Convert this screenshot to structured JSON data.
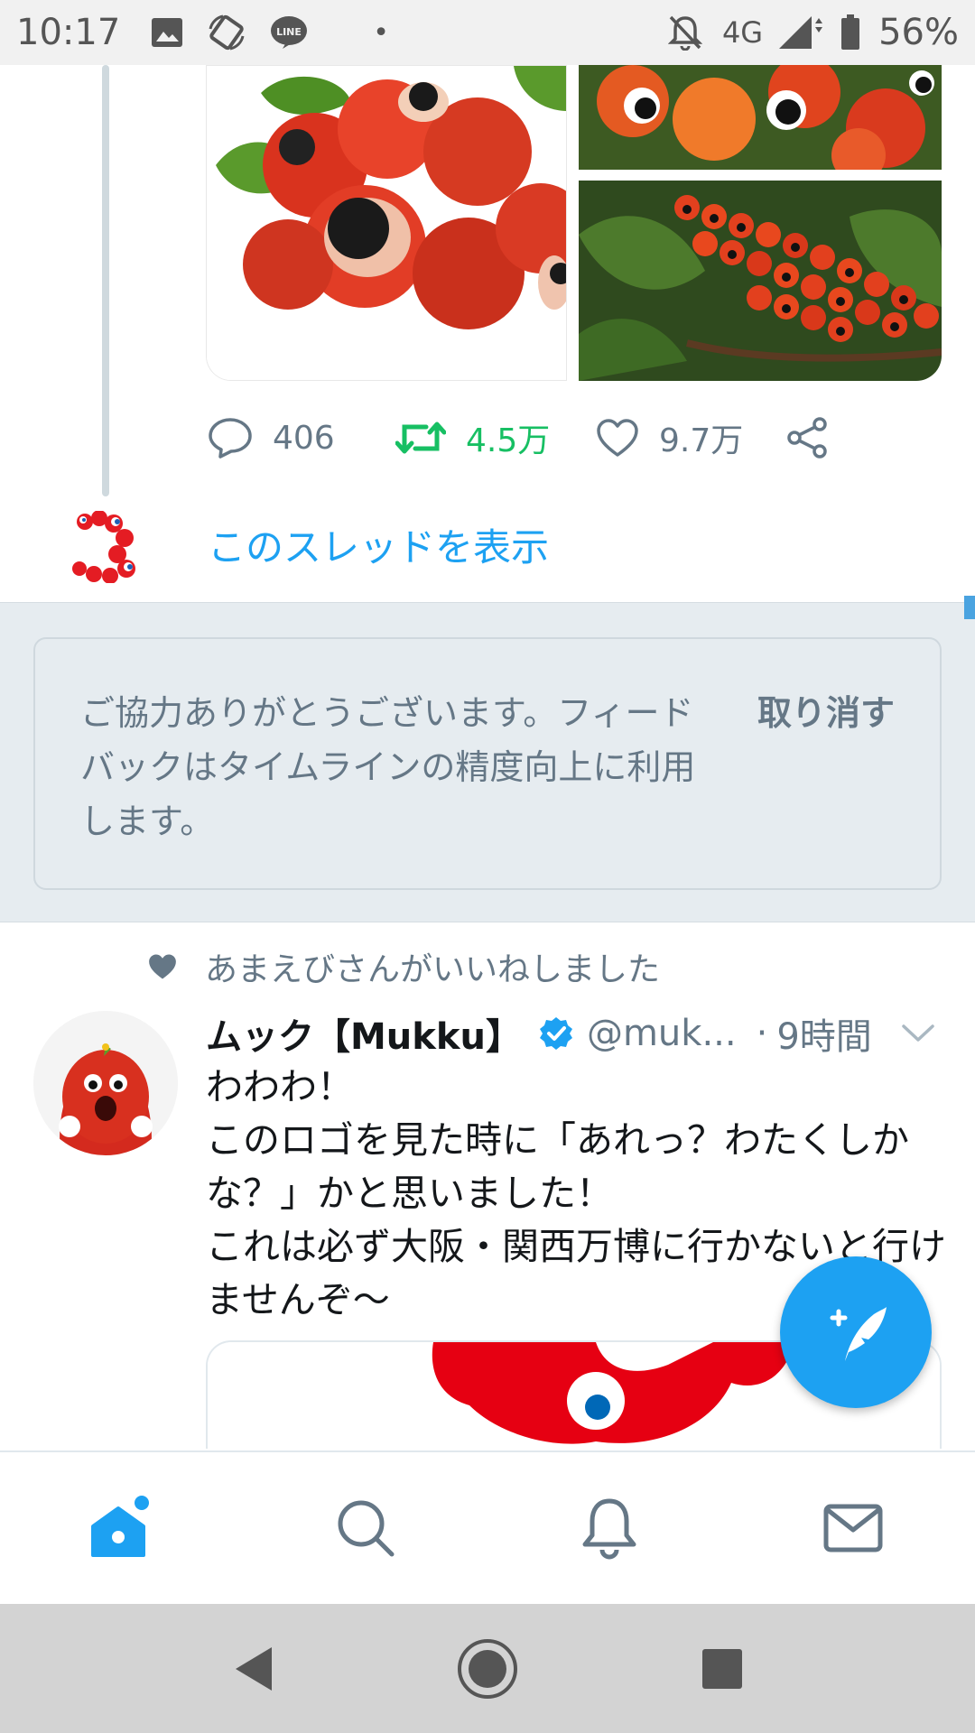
{
  "status_bar": {
    "time": "10:17",
    "network": "4G",
    "battery": "56%",
    "icons": [
      "image-icon",
      "sync-icon",
      "line-app-icon",
      "notifications-muted-icon",
      "signal-icon",
      "battery-icon"
    ],
    "dot": "•"
  },
  "previous_tweet": {
    "actions": {
      "reply_count": "406",
      "retweet_count": "4.5万",
      "like_count": "9.7万"
    },
    "show_thread_label": "このスレッドを表示"
  },
  "feedback": {
    "message": "ご協力ありがとうございます。フィードバックはタイムラインの精度向上に利用します。",
    "undo_label": "取り消す"
  },
  "tweet": {
    "social_context": "あまえびさんがいいねしました",
    "author_name": "ムック【Mukku】",
    "handle": "@muk...",
    "separator": "·",
    "time": "9時間",
    "text": "わわわ！\nこのロゴを見た時に「あれっ？わたくしかな？」かと思いました！\nこれは必ず大阪・関西万博に行かないと行けませんぞ〜"
  },
  "bottom_nav": {
    "items": [
      "home-icon",
      "search-icon",
      "notifications-icon",
      "messages-icon"
    ]
  },
  "colors": {
    "accent": "#1da1f2",
    "retweet": "#17bf63",
    "muted": "#657786",
    "feedback_bg": "#e6ecf0"
  }
}
